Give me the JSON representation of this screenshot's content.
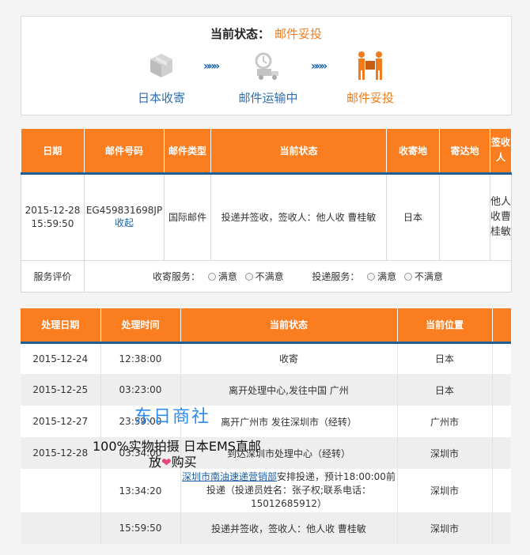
{
  "status": {
    "label": "当前状态：",
    "value": "邮件妥投",
    "steps": [
      {
        "label": "日本收寄",
        "icon": "box-icon"
      },
      {
        "label": "邮件运输中",
        "icon": "truck-icon"
      },
      {
        "label": "邮件妥投",
        "icon": "delivery-icon"
      }
    ],
    "arrow": "»»»"
  },
  "mail_table": {
    "headers": [
      "日期",
      "邮件号码",
      "邮件类型",
      "当前状态",
      "收寄地",
      "寄达地",
      "签收人"
    ],
    "row": {
      "date": "2015-12-28 15:59:50",
      "number": "EG459831698JP",
      "recall": "收起",
      "type": "国际邮件",
      "status": "投递并签收，签收人：他人收 曹桂敏",
      "origin": "日本",
      "destination": "",
      "signer": "他人收曹桂敏"
    },
    "eval": {
      "label": "服务评价",
      "pickup_label": "收寄服务：",
      "delivery_label": "投递服务：",
      "satisfied": "满意",
      "unsatisfied": "不满意"
    }
  },
  "track_table": {
    "headers": [
      "处理日期",
      "处理时间",
      "当前状态",
      "当前位置"
    ],
    "rows": [
      {
        "date": "2015-12-24",
        "time": "12:38:00",
        "status": "收寄",
        "location": "日本"
      },
      {
        "date": "2015-12-25",
        "time": "03:23:00",
        "status": "离开处理中心,发往中国 广州",
        "location": "日本"
      },
      {
        "date": "2015-12-27",
        "time": "23:59:00",
        "status": "离开广州市 发往深圳市（经转）",
        "location": "广州市"
      },
      {
        "date": "2015-12-28",
        "time": "03:34:00",
        "status": "到达深圳市处理中心（经转）",
        "location": "深圳市"
      },
      {
        "date": "",
        "time": "13:34:20",
        "status_link": "深圳市南油速递营销部",
        "status_rest": "安排投递，预计18:00:00前投递（投递员姓名：张子权;联系电话：15012685912）",
        "location": "深圳市"
      },
      {
        "date": "",
        "time": "15:59:50",
        "status": "投递并签收，签收人：他人收 曹桂敏",
        "location": "深圳市"
      }
    ]
  },
  "watermark": {
    "shop": "东日商社",
    "line1": "100%实物拍摄 日本EMS直邮",
    "buy_pre": "放",
    "heart": "❤",
    "buy_post": "购买"
  }
}
